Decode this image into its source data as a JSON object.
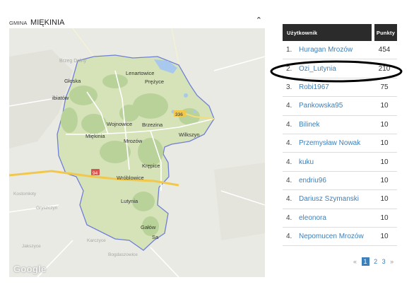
{
  "header": {
    "prefix": "GMINA",
    "name": "MIĘKINIA"
  },
  "map": {
    "places": {
      "brzeg_dolny": "Brzeg Dolny",
      "lenartowice": "Lenartowice",
      "glaska": "Głoska",
      "przyce": "Prężyce",
      "biatow": "ibiatów",
      "route_336": "336",
      "wojnowice": "Wojnowice",
      "brzezina": "Brzezina",
      "miekinia": "Miękinia",
      "wilkszyn": "Wilkszyn",
      "mrozow": "Mrozów",
      "krepice": "Krępice",
      "route_94": "94",
      "wroblowice": "Wróblowice",
      "lutynia": "Lutynia",
      "galow": "Gałów",
      "sadowice": "Sa",
      "kostomloty": "Kostomłoty",
      "gryszczyn": "Gryszczyn",
      "jakszyce": "Jakszyce",
      "kanczyce": "Karczyce",
      "bogdaszowice": "Bogdaszowice",
      "google": "Google"
    }
  },
  "ranking": {
    "headers": {
      "user": "Użytkownik",
      "points": "Punkty"
    },
    "rows": [
      {
        "pos": "1.",
        "user": "Huragan Mrozów",
        "points": "454"
      },
      {
        "pos": "2.",
        "user": "Ozi_Lutynia",
        "points": "210"
      },
      {
        "pos": "3.",
        "user": "Robi1967",
        "points": "75"
      },
      {
        "pos": "4.",
        "user": "Pankowska95",
        "points": "10"
      },
      {
        "pos": "4.",
        "user": "Bilinek",
        "points": "10"
      },
      {
        "pos": "4.",
        "user": "Przemysław Nowak",
        "points": "10"
      },
      {
        "pos": "4.",
        "user": "kuku",
        "points": "10"
      },
      {
        "pos": "4.",
        "user": "endriu96",
        "points": "10"
      },
      {
        "pos": "4.",
        "user": "Dariusz Szymanski",
        "points": "10"
      },
      {
        "pos": "4.",
        "user": "eleonora",
        "points": "10"
      },
      {
        "pos": "4.",
        "user": "Nepomucen Mrozów",
        "points": "10"
      }
    ]
  },
  "pager": {
    "prev": "«",
    "pages": [
      "1",
      "2",
      "3"
    ],
    "next": "»",
    "current": "1"
  },
  "colors": {
    "accent": "#3d7fb8",
    "header_bg": "#2b2b2b",
    "map_bg": "#eaeae4",
    "region_border": "#6f7fd6"
  }
}
